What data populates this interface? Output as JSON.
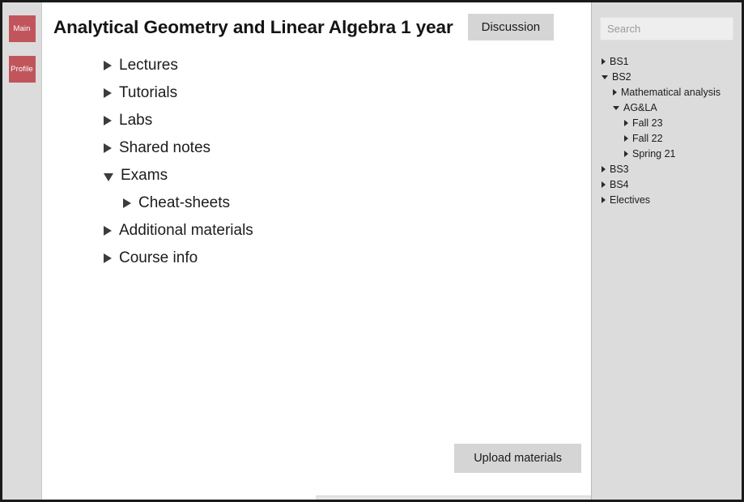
{
  "left_rail": {
    "buttons": [
      {
        "label": "Main",
        "icon": "home-icon"
      },
      {
        "label": "Profile",
        "icon": "user-icon"
      }
    ],
    "accent_color": "#c0565c"
  },
  "header": {
    "title": "Analytical Geometry and Linear Algebra 1 year",
    "discussion_label": "Discussion"
  },
  "main_tree": {
    "items": [
      {
        "label": "Lectures",
        "expanded": false,
        "depth": 0
      },
      {
        "label": "Tutorials",
        "expanded": false,
        "depth": 0
      },
      {
        "label": "Labs",
        "expanded": false,
        "depth": 0
      },
      {
        "label": "Shared notes",
        "expanded": false,
        "depth": 0
      },
      {
        "label": "Exams",
        "expanded": true,
        "depth": 0
      },
      {
        "label": "Cheat-sheets",
        "expanded": false,
        "depth": 1
      },
      {
        "label": "Additional materials",
        "expanded": false,
        "depth": 0
      },
      {
        "label": "Course info",
        "expanded": false,
        "depth": 0
      }
    ]
  },
  "footer": {
    "upload_label": "Upload materials"
  },
  "right_panel": {
    "search": {
      "value": "",
      "placeholder": "Search"
    },
    "tree": [
      {
        "label": "BS1",
        "expanded": false,
        "depth": 0
      },
      {
        "label": "BS2",
        "expanded": true,
        "depth": 0
      },
      {
        "label": "Mathematical analysis",
        "expanded": false,
        "depth": 1
      },
      {
        "label": "AG&LA",
        "expanded": true,
        "depth": 1
      },
      {
        "label": "Fall 23",
        "expanded": false,
        "depth": 2
      },
      {
        "label": "Fall 22",
        "expanded": false,
        "depth": 2
      },
      {
        "label": "Spring 21",
        "expanded": false,
        "depth": 2
      },
      {
        "label": "BS3",
        "expanded": false,
        "depth": 0
      },
      {
        "label": "BS4",
        "expanded": false,
        "depth": 0
      },
      {
        "label": "Electives",
        "expanded": false,
        "depth": 0
      }
    ]
  },
  "colors": {
    "panel_gray": "#dcdcdc",
    "button_gray": "#d5d5d5",
    "accent_red": "#c0565c",
    "text": "#1c1c1c"
  }
}
